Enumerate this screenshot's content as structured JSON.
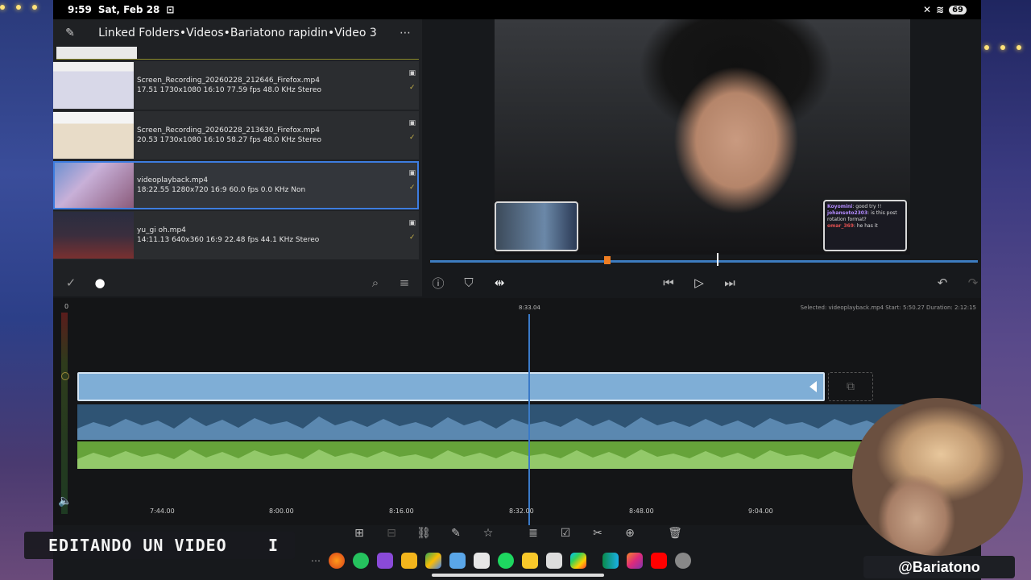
{
  "status_bar": {
    "time": "9:59",
    "date": "Sat, Feb 28",
    "battery": "69"
  },
  "browser": {
    "title": "Linked Folders•Videos•Bariatono rapidin•Video 3",
    "files": [
      {
        "name": "Screen_Recording_20260228_212646_Firefox.mp4",
        "meta": "17.51 1730x1080 16:10 77.59 fps 48.0 KHz Stereo"
      },
      {
        "name": "Screen_Recording_20260228_213630_Firefox.mp4",
        "meta": "20.53 1730x1080 16:10 58.27 fps 48.0 KHz Stereo"
      },
      {
        "name": "videoplayback.mp4",
        "meta": "18:22.55 1280x720 16:9 60.0 fps 0.0 KHz Non"
      },
      {
        "name": "yu_gi oh.mp4",
        "meta": "14:11.13 640x360 16:9 22.48 fps 44.1 KHz Stereo"
      }
    ]
  },
  "preview": {
    "chat": [
      {
        "user": "Koyomini",
        "text": ": good try !!"
      },
      {
        "user": "johansoto2303",
        "text": ": is this post rotation format?"
      },
      {
        "user": "omar_369",
        "text": ": he has it"
      }
    ]
  },
  "timeline": {
    "current_time": "8:33.04",
    "selection_info": "Selected: videoplayback.mp4 Start: 5:50.27 Duration: 2:12:15",
    "meter_zero": "0",
    "ruler": [
      "7:44.00",
      "8:00.00",
      "8:16.00",
      "8:32.00",
      "8:48.00",
      "9:04.00"
    ]
  },
  "overlay": {
    "banner": "EDITANDO UN VIDEO",
    "cursor": "I",
    "handle": "@Bariatono"
  }
}
